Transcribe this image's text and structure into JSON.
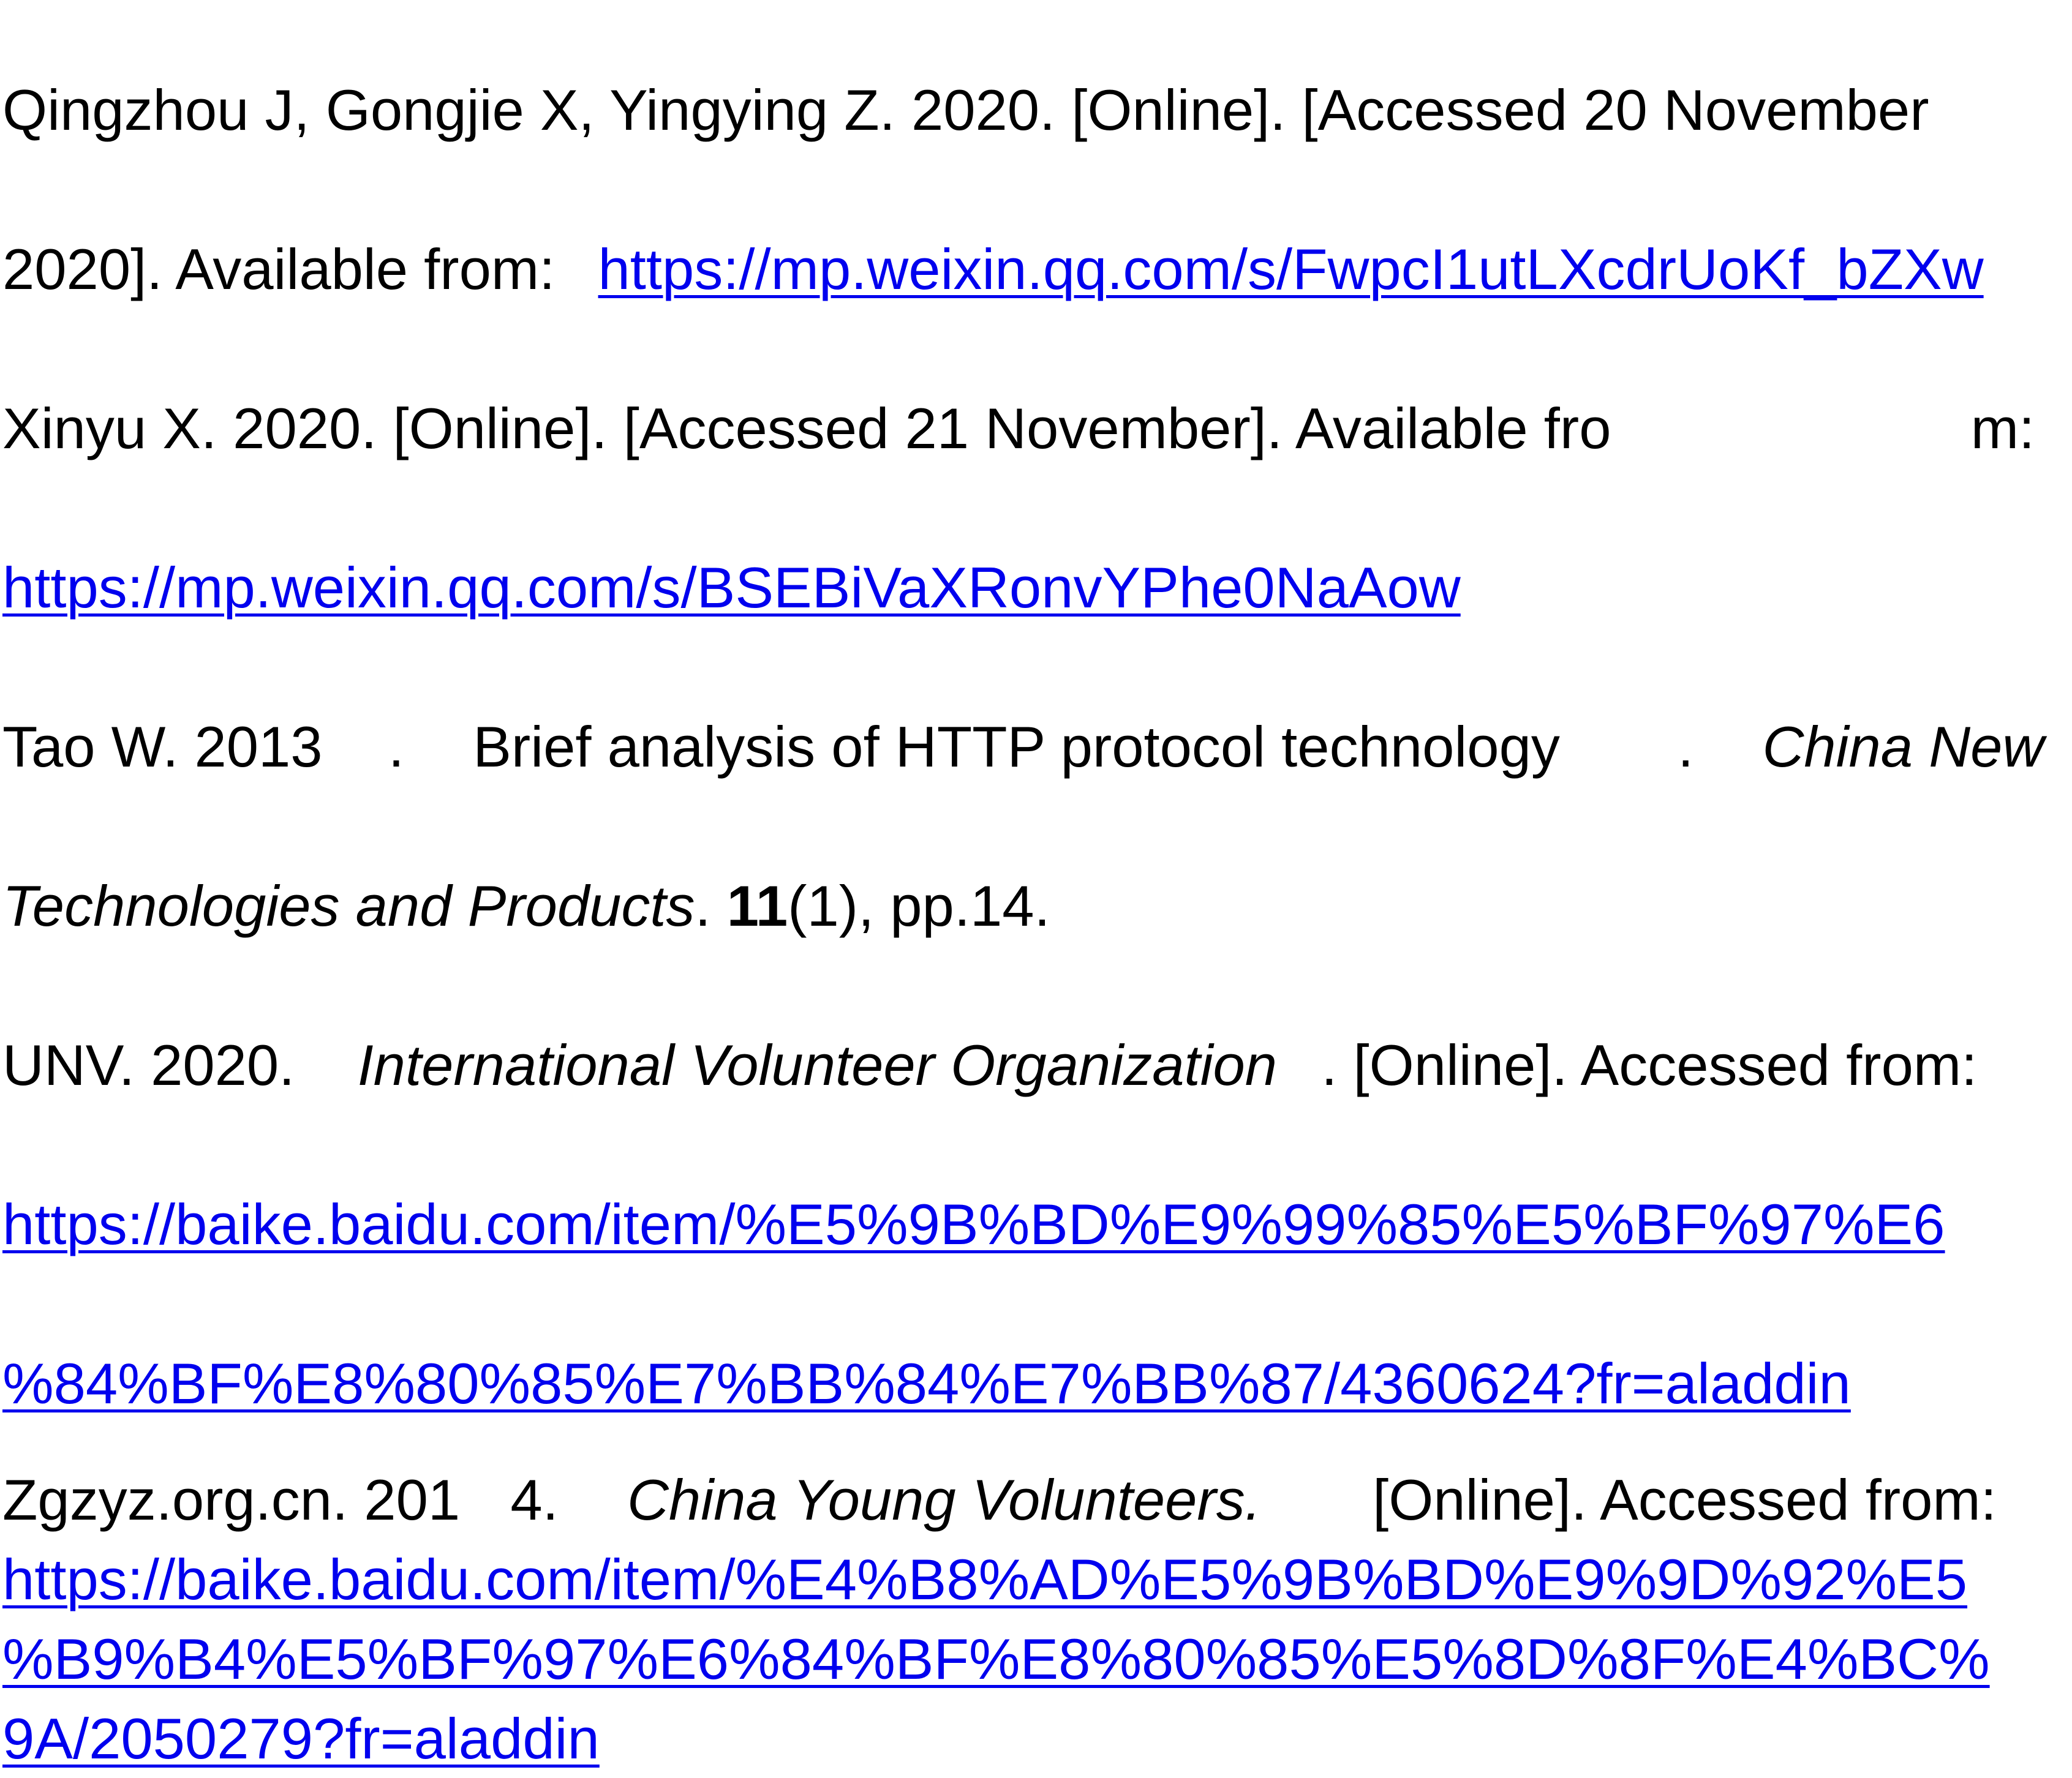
{
  "references": [
    {
      "entry": "qingzhou",
      "line1": "Qingzhou J, Gongjie X, Yingying Z. 2020. [Online]. [Accessed 20 November",
      "line2_prefix": "2020]. Available from:",
      "url": "https://mp.weixin.qq.com/s/FwpcI1utLXcdrUoKf_bZXw"
    },
    {
      "entry": "xinyu",
      "line1_prefix": "Xinyu X. 2020. [Online]. [Accessed 21 November]. Available fro",
      "line1_suffix": "m:",
      "url": "https://mp.weixin.qq.com/s/BSEBiVaXRonvYPhe0NaAow"
    },
    {
      "entry": "tao",
      "author_year": "Tao W. 2013",
      "dot1": ".",
      "title": "Brief analysis of HTTP protocol technology",
      "dot2": ".",
      "journal_part1": "China New",
      "journal_part2": "Technologies and Products",
      "dot3": ".",
      "volume": "11",
      "issue_pages": "(1), pp.14."
    },
    {
      "entry": "unv",
      "author_year": "UNV. 2020.",
      "title": "International Volunteer Organization",
      "tail": ". [Online]. Accessed from:",
      "url_line1": "https://baike.baidu.com/item/%E5%9B%BD%E9%99%85%E5%BF%97%E6",
      "url_line2": "%84%BF%E8%80%85%E7%BB%84%E7%BB%87/4360624?fr=aladdin"
    },
    {
      "entry": "zgzyz",
      "author_year": "Zgzyz.org.cn. 201",
      "year_tail": "4.",
      "title": "China Young Volunteers.",
      "tail": "[Online]. Accessed from:",
      "url_line1": "https://baike.baidu.com/item/%E4%B8%AD%E5%9B%BD%E9%9D%92%E5",
      "url_line2": "%B9%B4%E5%BF%97%E6%84%BF%E8%80%85%E5%8D%8F%E4%BC%",
      "url_line3": "9A/2050279?fr=aladdin"
    }
  ]
}
